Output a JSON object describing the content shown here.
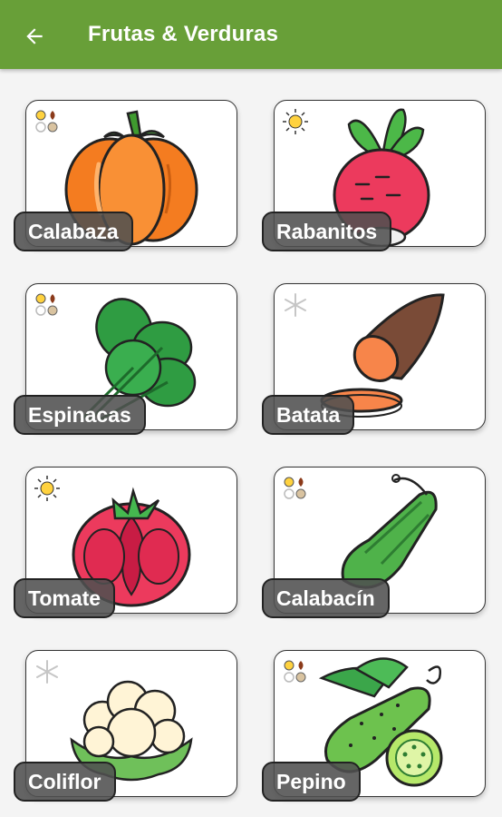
{
  "appbar": {
    "title": "Frutas & Verduras",
    "color": "#689f38",
    "back_icon": "arrow-back-icon"
  },
  "items": [
    {
      "name": "Calabaza",
      "icon": "pumpkin-icon",
      "season": "multi-season-icon"
    },
    {
      "name": "Rabanitos",
      "icon": "radish-icon",
      "season": "sun-icon"
    },
    {
      "name": "Espinacas",
      "icon": "spinach-icon",
      "season": "multi-season-icon"
    },
    {
      "name": "Batata",
      "icon": "sweet-potato-icon",
      "season": "snowflake-icon"
    },
    {
      "name": "Tomate",
      "icon": "tomato-icon",
      "season": "sun-icon"
    },
    {
      "name": "Calabacín",
      "icon": "zucchini-icon",
      "season": "multi-season-icon"
    },
    {
      "name": "Coliflor",
      "icon": "cauliflower-icon",
      "season": "snowflake-icon"
    },
    {
      "name": "Pepino",
      "icon": "cucumber-icon",
      "season": "multi-season-icon"
    }
  ]
}
